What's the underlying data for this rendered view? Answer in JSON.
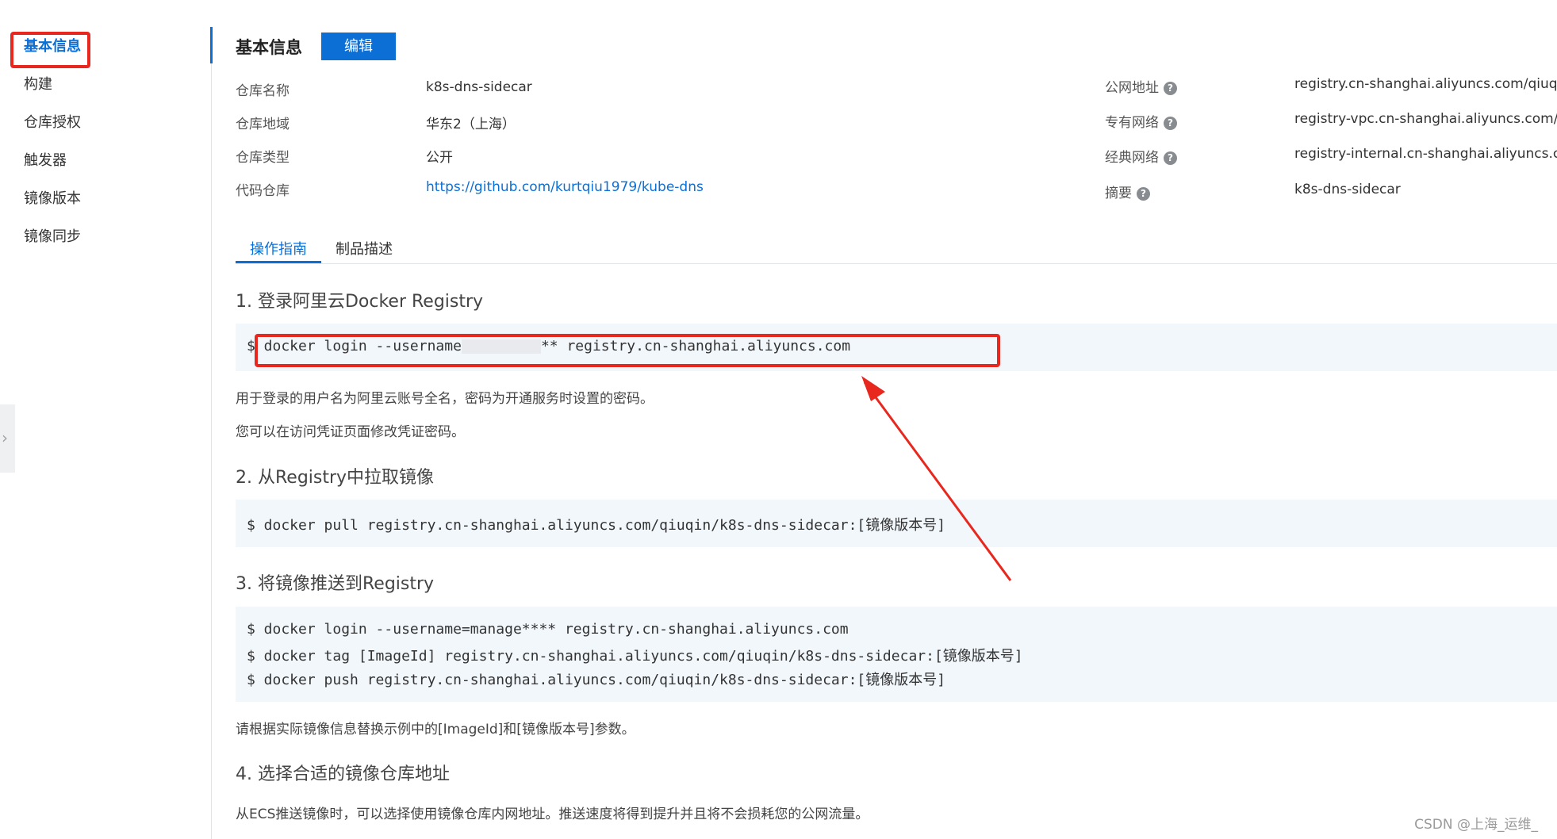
{
  "sidebar": {
    "items": [
      {
        "label": "基本信息",
        "active": true
      },
      {
        "label": "构建"
      },
      {
        "label": "仓库授权"
      },
      {
        "label": "触发器"
      },
      {
        "label": "镜像版本"
      },
      {
        "label": "镜像同步"
      }
    ],
    "collapse_icon": "chevron-right-icon"
  },
  "header": {
    "title": "基本信息",
    "edit_label": "编辑"
  },
  "info_left": [
    {
      "label": "仓库名称",
      "value": "k8s-dns-sidecar"
    },
    {
      "label": "仓库地域",
      "value": "华东2（上海）"
    },
    {
      "label": "仓库类型",
      "value": "公开"
    },
    {
      "label": "代码仓库",
      "value": "https://github.com/kurtqiu1979/kube-dns"
    }
  ],
  "info_right": [
    {
      "label": "公网地址",
      "value": "registry.cn-shanghai.aliyuncs.com/qiuqin/"
    },
    {
      "label": "专有网络",
      "value": "registry-vpc.cn-shanghai.aliyuncs.com/qiu"
    },
    {
      "label": "经典网络",
      "value": "registry-internal.cn-shanghai.aliyuncs.com"
    },
    {
      "label": "摘要",
      "value": "k8s-dns-sidecar"
    }
  ],
  "help_icon": "?",
  "tabs": [
    {
      "label": "操作指南",
      "active": true
    },
    {
      "label": "制品描述"
    }
  ],
  "guide": {
    "s1_title": "1. 登录阿里云Docker Registry",
    "s1_cmd_prefix": "$ docker login --username",
    "s1_cmd_suffix": "** registry.cn-shanghai.aliyuncs.com",
    "s1_desc1": "用于登录的用户名为阿里云账号全名，密码为开通服务时设置的密码。",
    "s1_desc2": "您可以在访问凭证页面修改凭证密码。",
    "s2_title": "2. 从Registry中拉取镜像",
    "s2_cmd": "$ docker pull registry.cn-shanghai.aliyuncs.com/qiuqin/k8s-dns-sidecar:[镜像版本号]",
    "s3_title": "3. 将镜像推送到Registry",
    "s3_cmd1": "$ docker login --username=manage**** registry.cn-shanghai.aliyuncs.com",
    "s3_cmd2": "$ docker tag [ImageId] registry.cn-shanghai.aliyuncs.com/qiuqin/k8s-dns-sidecar:[镜像版本号]",
    "s3_cmd3": "$ docker push registry.cn-shanghai.aliyuncs.com/qiuqin/k8s-dns-sidecar:[镜像版本号]",
    "s3_desc": "请根据实际镜像信息替换示例中的[ImageId]和[镜像版本号]参数。",
    "s4_title": "4. 选择合适的镜像仓库地址",
    "s4_desc": "从ECS推送镜像时，可以选择使用镜像仓库内网地址。推送速度将得到提升并且将不会损耗您的公网流量。"
  },
  "watermark": "CSDN @上海_运维_",
  "annotation_color": "#e8281e",
  "accent_color": "#0b6fd6"
}
